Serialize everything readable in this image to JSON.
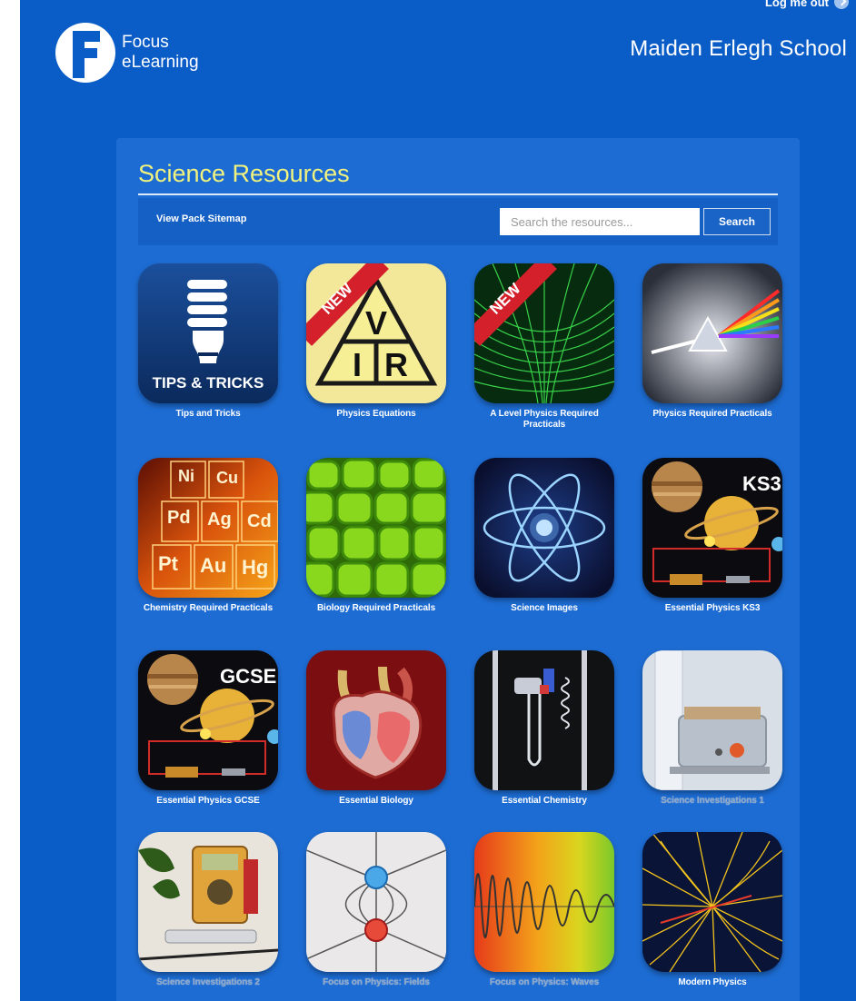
{
  "header": {
    "logout_label": "Log me out",
    "logo_line1": "Focus",
    "logo_line2": "eLearning",
    "school_name": "Maiden Erlegh School"
  },
  "panel": {
    "title": "Science Resources",
    "sitemap_link": "View Pack Sitemap",
    "search_placeholder": "Search the resources...",
    "search_button": "Search"
  },
  "tiles": [
    {
      "label": "Tips and Tricks",
      "icon": "lightbulb-icon",
      "badge_text": "TIPS & TRICKS"
    },
    {
      "label": "Physics Equations",
      "icon": "vir-triangle-icon",
      "ribbon": "NEW",
      "triangle": [
        "V",
        "I",
        "R"
      ]
    },
    {
      "label": "A Level Physics Required Practicals",
      "icon": "green-grid-icon",
      "ribbon": "NEW"
    },
    {
      "label": "Physics Required Practicals",
      "icon": "prism-icon"
    },
    {
      "label": "Chemistry Required Practicals",
      "icon": "periodic-table-icon",
      "elements": [
        "Ni",
        "Cu",
        "Pd",
        "Ag",
        "Cd",
        "Pt",
        "Au",
        "Hg"
      ]
    },
    {
      "label": "Biology Required Practicals",
      "icon": "cells-icon"
    },
    {
      "label": "Science Images",
      "icon": "atom-icon"
    },
    {
      "label": "Essential Physics KS3",
      "icon": "planets-ks3-icon",
      "badge_text": "KS3"
    },
    {
      "label": "Essential Physics GCSE",
      "icon": "planets-gcse-icon",
      "badge_text": "GCSE"
    },
    {
      "label": "Essential Biology",
      "icon": "heart-icon"
    },
    {
      "label": "Essential Chemistry",
      "icon": "lab-apparatus-icon"
    },
    {
      "label": "Science Investigations 1",
      "icon": "water-bath-icon",
      "faded": true
    },
    {
      "label": "Science Investigations 2",
      "icon": "multimeter-icon",
      "faded": true
    },
    {
      "label": "Focus on Physics: Fields",
      "icon": "field-lines-icon",
      "faded": true
    },
    {
      "label": "Focus on Physics: Waves",
      "icon": "wave-icon",
      "faded": true
    },
    {
      "label": "Modern Physics",
      "icon": "particle-tracks-icon"
    }
  ],
  "colors": {
    "page_bg": "#0a5cc7",
    "panel_bg": "#1d6cd3",
    "title": "#f1f37e"
  }
}
